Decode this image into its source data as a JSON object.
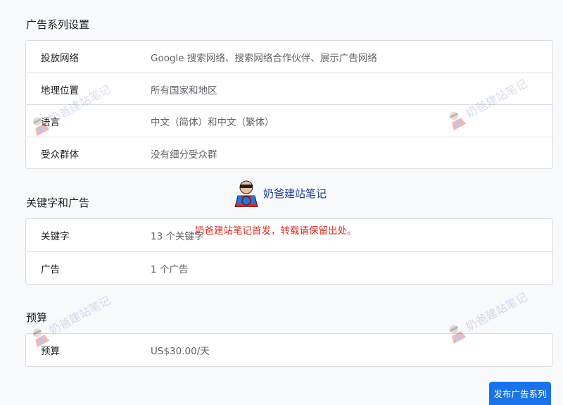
{
  "campaign_settings": {
    "title": "广告系列设置",
    "rows": [
      {
        "label": "投放网络",
        "value": "Google 搜索网络、搜索网络合作伙伴、展示广告网络"
      },
      {
        "label": "地理位置",
        "value": "所有国家和地区"
      },
      {
        "label": "语言",
        "value": "中文（简体）和中文（繁体）"
      },
      {
        "label": "受众群体",
        "value": "没有细分受众群"
      }
    ]
  },
  "keywords_ads": {
    "title": "关键字和广告",
    "rows": [
      {
        "label": "关键字",
        "value": "13 个关键字"
      },
      {
        "label": "广告",
        "value": "1 个广告"
      }
    ]
  },
  "budget": {
    "title": "预算",
    "rows": [
      {
        "label": "预算",
        "value": "US$30.00/天"
      }
    ]
  },
  "publish_button": {
    "label": "发布广告系列"
  },
  "watermark": {
    "text": "奶爸建站笔记",
    "notice": "奶爸建站笔记首发，转载请保留出处。",
    "icon": "superhero-avatar-icon"
  },
  "colors": {
    "accent": "#1a73e8",
    "notice": "#d93025",
    "watermark_text": "#1a3a8f"
  }
}
